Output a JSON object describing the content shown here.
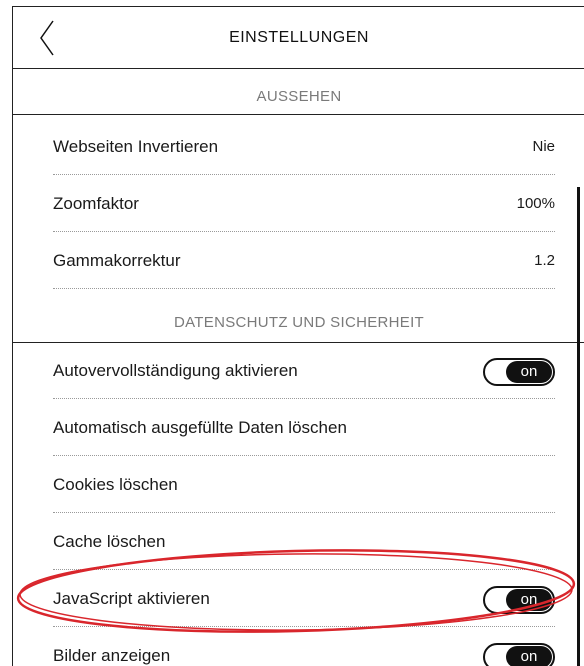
{
  "header": {
    "title": "EINSTELLUNGEN"
  },
  "sections": {
    "appearance": "AUSSEHEN",
    "privacy": "DATENSCHUTZ UND SICHERHEIT"
  },
  "appearance_rows": [
    {
      "label": "Webseiten Invertieren",
      "value": "Nie"
    },
    {
      "label": "Zoomfaktor",
      "value": "100%"
    },
    {
      "label": "Gammakorrektur",
      "value": "1.2"
    }
  ],
  "privacy_rows": [
    {
      "label": "Autovervollständigung aktivieren",
      "toggle": "on"
    },
    {
      "label": "Automatisch ausgefüllte Daten löschen"
    },
    {
      "label": "Cookies löschen"
    },
    {
      "label": "Cache löschen"
    },
    {
      "label": "JavaScript aktivieren",
      "toggle": "on"
    },
    {
      "label": "Bilder anzeigen",
      "toggle": "on"
    }
  ],
  "colors": {
    "highlight": "#d9262c",
    "toggle_fill": "#111111",
    "section_text": "#7a7a7a"
  }
}
